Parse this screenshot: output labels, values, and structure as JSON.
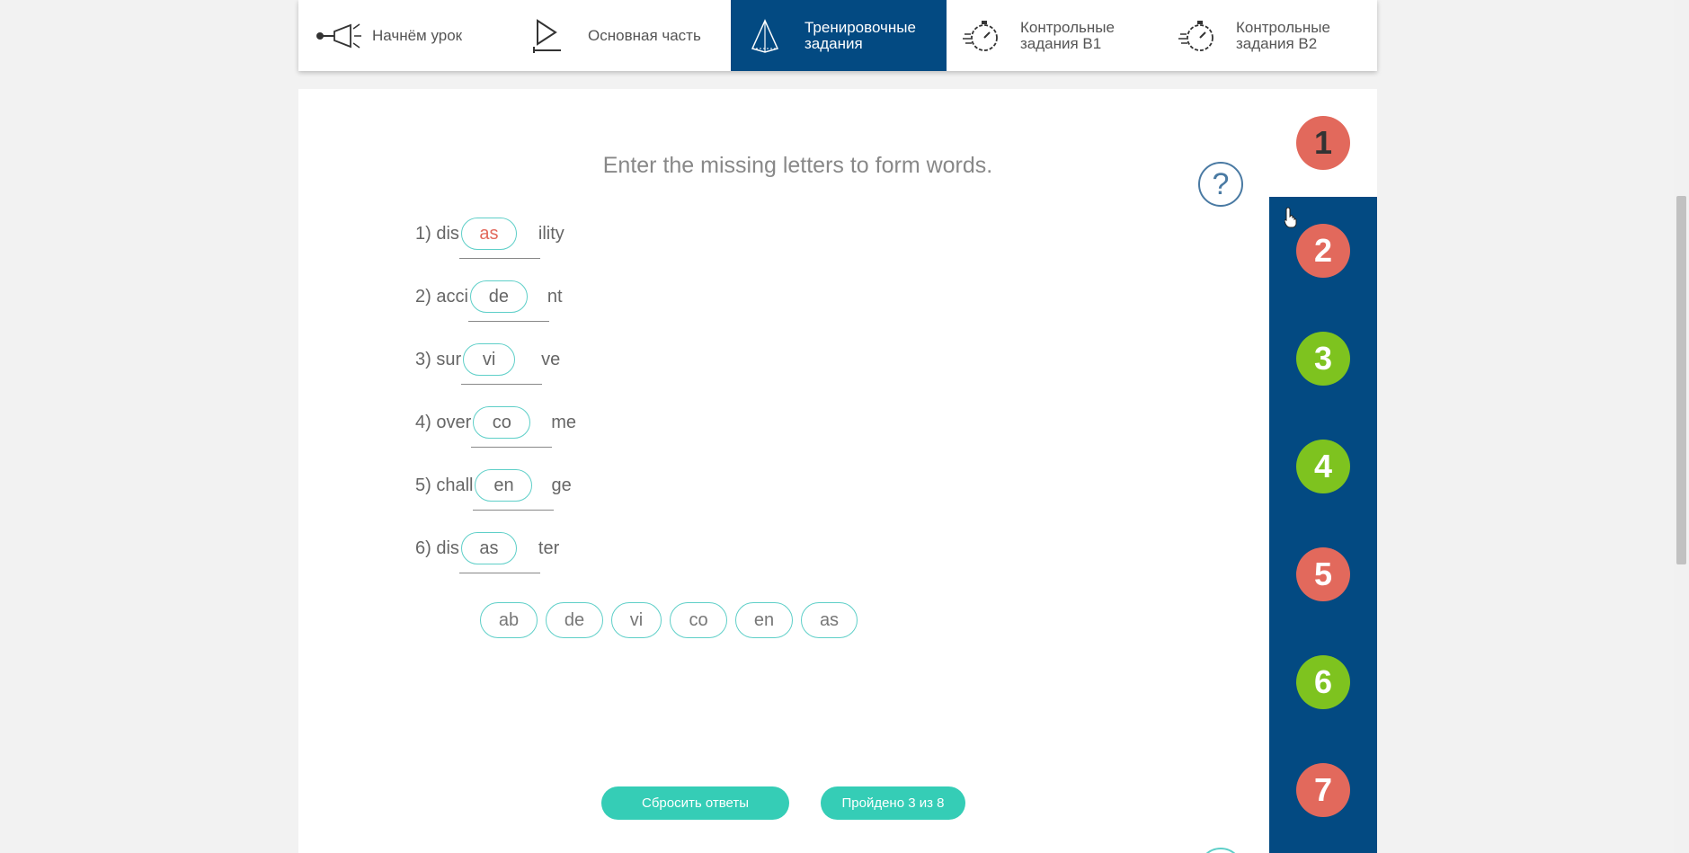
{
  "nav": {
    "items": [
      {
        "label": "Начнём урок",
        "icon": "megaphone-icon"
      },
      {
        "label": "Основная часть",
        "icon": "play-icon"
      },
      {
        "label": "Тренировочные задания",
        "icon": "pyramid-icon"
      },
      {
        "label": "Контрольные задания В1",
        "icon": "stopwatch-icon"
      },
      {
        "label": "Контрольные задания В2",
        "icon": "stopwatch-icon"
      }
    ],
    "active_index": 2
  },
  "exercise": {
    "instruction": "Enter the missing letters to form words.",
    "help": "?",
    "rows": [
      {
        "prefix": "1) dis",
        "answer": "as",
        "suffix": "ility",
        "status": "wrong"
      },
      {
        "prefix": "2) acci",
        "answer": "de",
        "suffix": "nt",
        "status": "normal"
      },
      {
        "prefix": "3) sur",
        "answer": "vi",
        "suffix": "ve",
        "status": "normal"
      },
      {
        "prefix": "4) over",
        "answer": "co",
        "suffix": "me",
        "status": "normal"
      },
      {
        "prefix": "5) chall",
        "answer": "en",
        "suffix": "ge",
        "status": "normal"
      },
      {
        "prefix": "6) dis",
        "answer": "as",
        "suffix": "ter",
        "status": "normal"
      }
    ],
    "word_bank": [
      "ab",
      "de",
      "vi",
      "co",
      "en",
      "as"
    ]
  },
  "buttons": {
    "reset": "Сбросить ответы",
    "progress": "Пройдено 3 из 8"
  },
  "steps": [
    {
      "label": "1",
      "color": "#e2695c"
    },
    {
      "label": "2",
      "color": "#e2695c"
    },
    {
      "label": "3",
      "color": "#7ec31f"
    },
    {
      "label": "4",
      "color": "#7ec31f"
    },
    {
      "label": "5",
      "color": "#e2695c"
    },
    {
      "label": "6",
      "color": "#7ec31f"
    },
    {
      "label": "7",
      "color": "#e2695c"
    }
  ],
  "colors": {
    "nav_active": "#034a82",
    "accent_teal": "#35cdb6",
    "wrong": "#e2695c",
    "correct": "#7ec31f"
  }
}
